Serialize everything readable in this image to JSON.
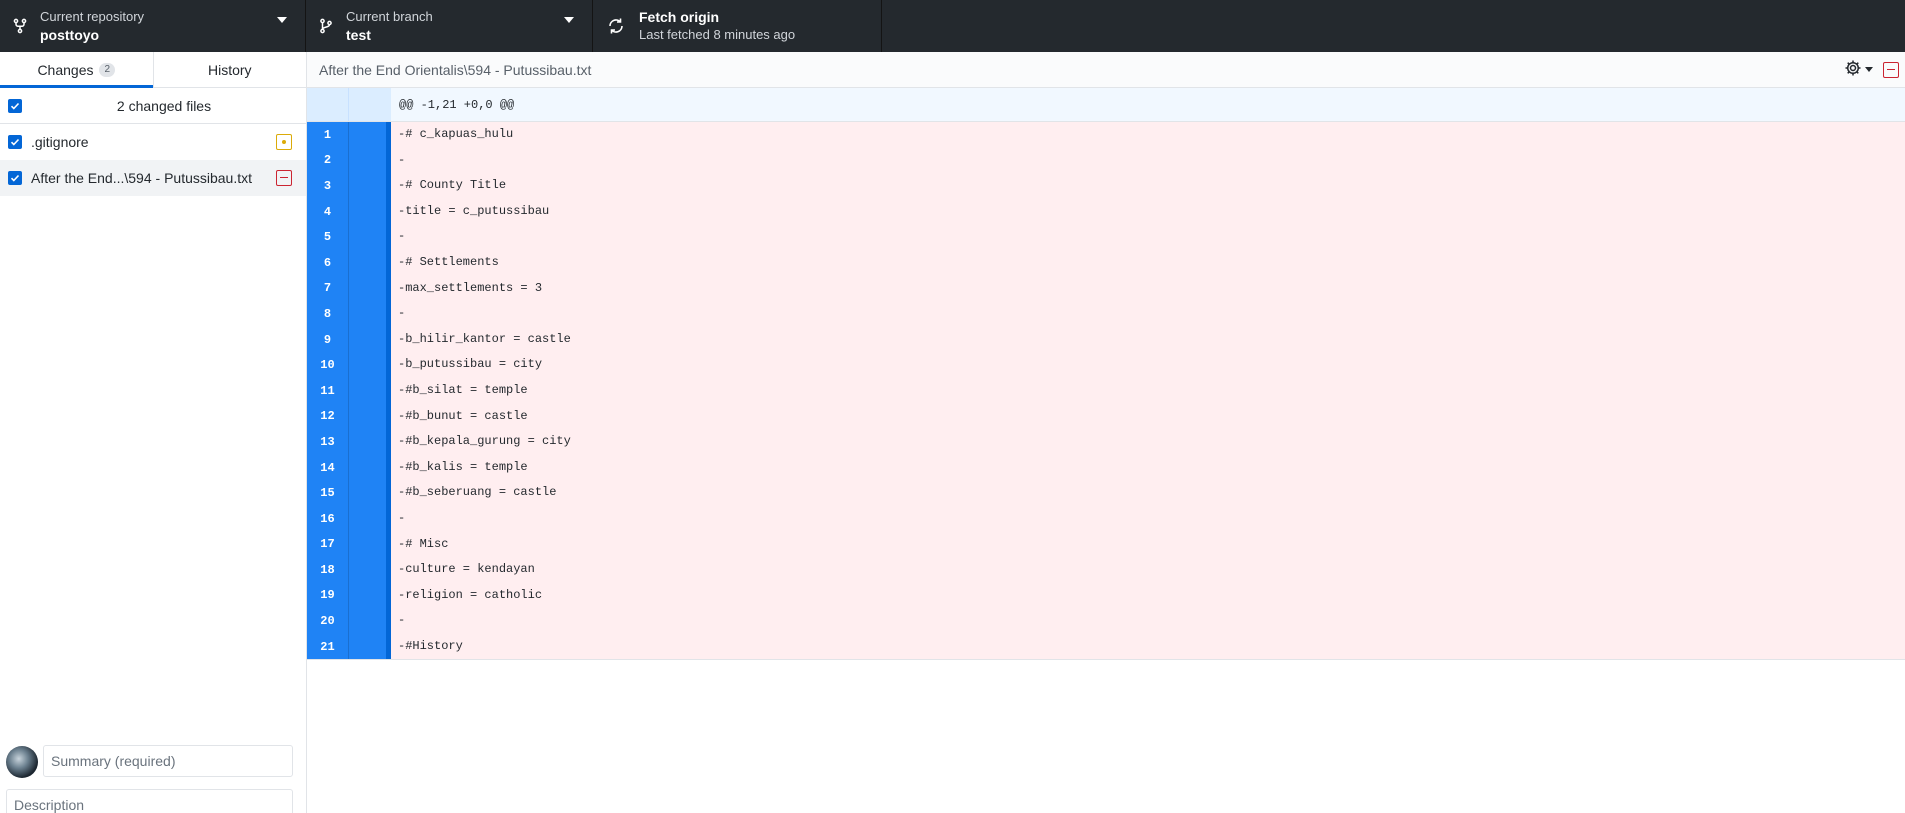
{
  "toolbar": {
    "repo": {
      "description": "Current repository",
      "title": "posttoyo"
    },
    "branch": {
      "description": "Current branch",
      "title": "test"
    },
    "fetch": {
      "title": "Fetch origin",
      "description": "Last fetched 8 minutes ago"
    }
  },
  "sidebar": {
    "tabs": [
      {
        "label": "Changes",
        "count": "2"
      },
      {
        "label": "History"
      }
    ],
    "files_header": "2 changed files",
    "files": [
      {
        "name": ".gitignore",
        "status": "modified"
      },
      {
        "name": "After the End...\\594 - Putussibau.txt",
        "status": "deleted"
      }
    ],
    "commit": {
      "summary_placeholder": "Summary (required)",
      "description_placeholder": "Description"
    }
  },
  "diff": {
    "path": "After the End Orientalis\\594 - Putussibau.txt",
    "hunk_header": "@@ -1,21 +0,0 @@",
    "lines": [
      {
        "num": "1",
        "text": "-# c_kapuas_hulu"
      },
      {
        "num": "2",
        "text": "-"
      },
      {
        "num": "3",
        "text": "-# County Title"
      },
      {
        "num": "4",
        "text": "-title = c_putussibau"
      },
      {
        "num": "5",
        "text": "-"
      },
      {
        "num": "6",
        "text": "-# Settlements"
      },
      {
        "num": "7",
        "text": "-max_settlements = 3"
      },
      {
        "num": "8",
        "text": "-"
      },
      {
        "num": "9",
        "text": "-b_hilir_kantor = castle"
      },
      {
        "num": "10",
        "text": "-b_putussibau = city"
      },
      {
        "num": "11",
        "text": "-#b_silat = temple"
      },
      {
        "num": "12",
        "text": "-#b_bunut = castle"
      },
      {
        "num": "13",
        "text": "-#b_kepala_gurung = city"
      },
      {
        "num": "14",
        "text": "-#b_kalis = temple"
      },
      {
        "num": "15",
        "text": "-#b_seberuang = castle"
      },
      {
        "num": "16",
        "text": "-"
      },
      {
        "num": "17",
        "text": "-# Misc"
      },
      {
        "num": "18",
        "text": "-culture = kendayan"
      },
      {
        "num": "19",
        "text": "-religion = catholic"
      },
      {
        "num": "20",
        "text": "-"
      },
      {
        "num": "21",
        "text": "-#History"
      }
    ]
  },
  "colors": {
    "toolbar_bg": "#24292e",
    "accent": "#0366d6",
    "deleted_bg": "#ffeef0",
    "deleted_status": "#cb2431",
    "modified_status": "#dbab09",
    "gutter_selected": "#1f83f5"
  },
  "icons": {
    "repo": "repo-forked-icon",
    "branch": "git-branch-icon",
    "fetch": "sync-icon",
    "settings": "gear-icon",
    "file_modified": "diff-modified-icon",
    "file_deleted": "diff-removed-icon"
  }
}
